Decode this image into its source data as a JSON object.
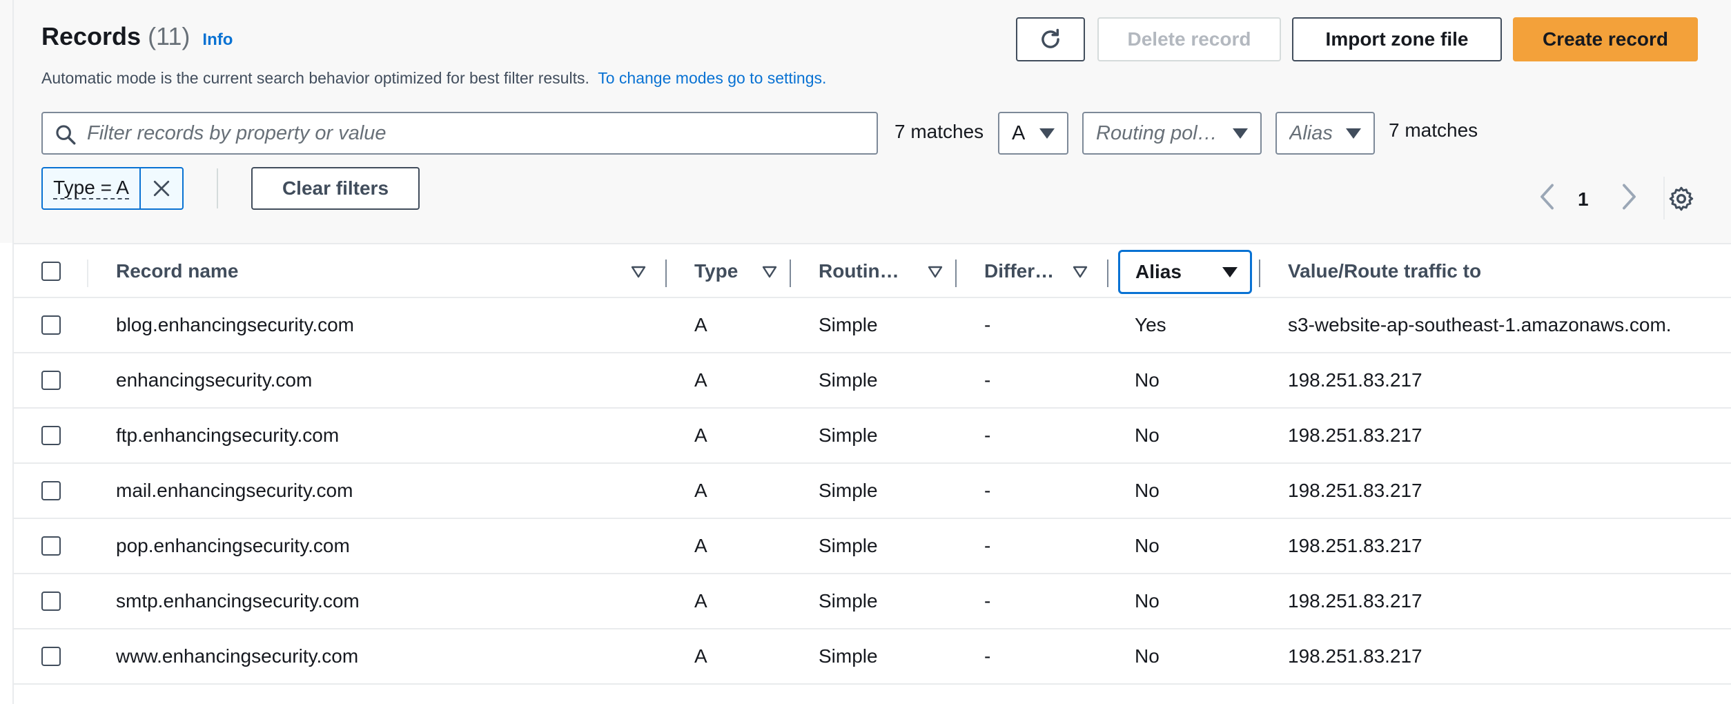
{
  "header": {
    "title": "Records",
    "count": "(11)",
    "info_label": "Info",
    "description": "Automatic mode is the current search behavior optimized for best filter results.",
    "settings_link": "To change modes go to settings."
  },
  "actions": {
    "refresh_icon": "refresh-icon",
    "delete_label": "Delete record",
    "import_label": "Import zone file",
    "create_label": "Create record"
  },
  "filters": {
    "search_placeholder": "Filter records by property or value",
    "search_value": "",
    "matches_text": "7 matches",
    "type_select": "A",
    "routing_select": "Routing pol…",
    "alias_select": "Alias",
    "matches_text_2": "7 matches",
    "token_label": "Type = A",
    "clear_filters_label": "Clear filters"
  },
  "pagination": {
    "current_page": "1"
  },
  "table": {
    "columns": {
      "record_name": "Record name",
      "type": "Type",
      "routing": "Routin…",
      "differ": "Differ…",
      "alias": "Alias",
      "value": "Value/Route traffic to"
    },
    "rows": [
      {
        "name": "blog.enhancingsecurity.com",
        "type": "A",
        "routing": "Simple",
        "differ": "-",
        "alias": "Yes",
        "value": "s3-website-ap-southeast-1.amazonaws.com."
      },
      {
        "name": "enhancingsecurity.com",
        "type": "A",
        "routing": "Simple",
        "differ": "-",
        "alias": "No",
        "value": "198.251.83.217"
      },
      {
        "name": "ftp.enhancingsecurity.com",
        "type": "A",
        "routing": "Simple",
        "differ": "-",
        "alias": "No",
        "value": "198.251.83.217"
      },
      {
        "name": "mail.enhancingsecurity.com",
        "type": "A",
        "routing": "Simple",
        "differ": "-",
        "alias": "No",
        "value": "198.251.83.217"
      },
      {
        "name": "pop.enhancingsecurity.com",
        "type": "A",
        "routing": "Simple",
        "differ": "-",
        "alias": "No",
        "value": "198.251.83.217"
      },
      {
        "name": "smtp.enhancingsecurity.com",
        "type": "A",
        "routing": "Simple",
        "differ": "-",
        "alias": "No",
        "value": "198.251.83.217"
      },
      {
        "name": "www.enhancingsecurity.com",
        "type": "A",
        "routing": "Simple",
        "differ": "-",
        "alias": "No",
        "value": "198.251.83.217"
      }
    ]
  },
  "colors": {
    "accent": "#f3a13a",
    "link": "#0972d3",
    "text": "#16191f",
    "muted": "#687078"
  }
}
